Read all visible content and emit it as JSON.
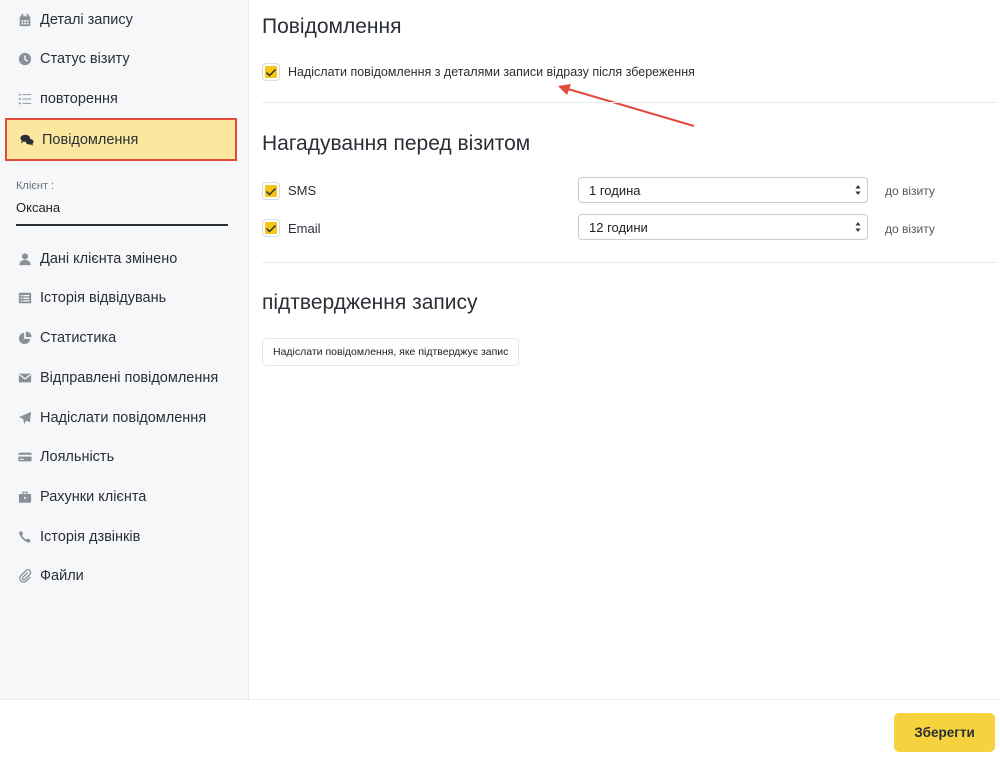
{
  "sidebar": {
    "items": [
      {
        "label": "Деталі запису",
        "icon": "calendar-icon"
      },
      {
        "label": "Статус візиту",
        "icon": "clock-icon"
      },
      {
        "label": "повторення",
        "icon": "list-icon"
      },
      {
        "label": "Повідомлення",
        "icon": "chat-icon",
        "active": true
      },
      {
        "label": "Дані клієнта змінено",
        "icon": "user-icon"
      },
      {
        "label": "Історія відвідувань",
        "icon": "history-list-icon"
      },
      {
        "label": "Статистика",
        "icon": "pie-chart-icon"
      },
      {
        "label": "Відправлені повідомлення",
        "icon": "envelope-icon"
      },
      {
        "label": "Надіслати повідомлення",
        "icon": "paper-plane-icon"
      },
      {
        "label": "Лояльність",
        "icon": "credit-card-icon"
      },
      {
        "label": "Рахунки клієнта",
        "icon": "briefcase-icon"
      },
      {
        "label": "Історія дзвінків",
        "icon": "phone-icon"
      },
      {
        "label": "Файли",
        "icon": "paperclip-icon"
      }
    ],
    "client": {
      "label": "Клієнт :",
      "value": "Оксана"
    }
  },
  "main": {
    "notifications": {
      "title": "Повідомлення",
      "send_details_label": "Надіслати повідомлення з деталями записи відразу після збереження",
      "send_details_checked": true
    },
    "reminders": {
      "title": "Нагадування перед візитом",
      "rows": [
        {
          "label": "SMS",
          "checked": true,
          "value": "1 година",
          "suffix": "до візиту"
        },
        {
          "label": "Email",
          "checked": true,
          "value": "12 години",
          "suffix": "до візиту"
        }
      ]
    },
    "confirmation": {
      "title": "підтвердження запису",
      "button_label": "Надіслати повідомлення, яке підтверджує запис"
    }
  },
  "footer": {
    "save_label": "Зберегти"
  },
  "colors": {
    "accent": "#f6d23e",
    "active_bg": "#fbe89e",
    "highlight_border": "#e04a3c"
  }
}
